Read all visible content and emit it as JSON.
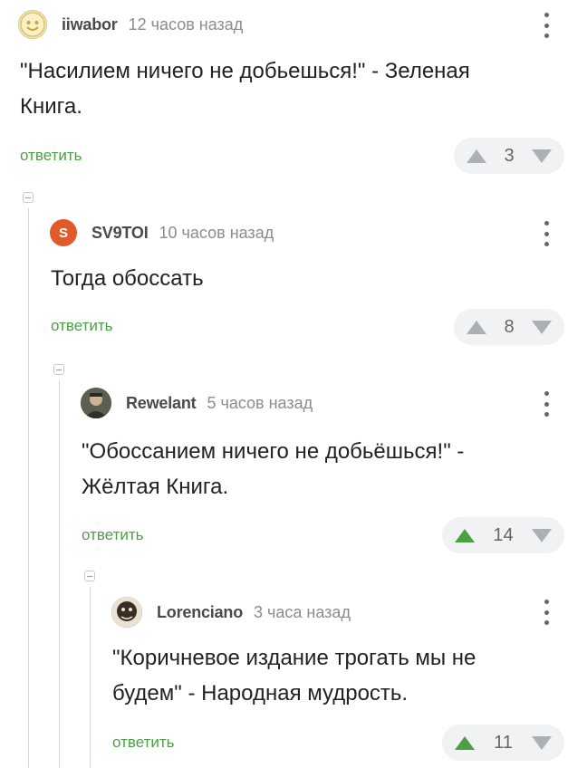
{
  "colors": {
    "accent_green": "#4d9f43",
    "vote_neutral": "#aab0b4",
    "avatar_sv9toi": "#e05a2a"
  },
  "common": {
    "reply_label": "ответить"
  },
  "comments": [
    {
      "username": "iiwabor",
      "time": "12 часов назад",
      "avatar_icon": "smiley-face-icon",
      "text_lines": [
        "\"Насилием ничего не добьешься!\" - Зеленая",
        "Книга."
      ],
      "rating": "3",
      "upvoted": false
    },
    {
      "username": "SV9TOI",
      "time": "10 часов назад",
      "avatar_letter": "S",
      "text_lines": [
        "Тогда обоссать"
      ],
      "rating": "8",
      "upvoted": false
    },
    {
      "username": "Rewelant",
      "time": "5 часов назад",
      "avatar_icon": "photo-avatar-icon",
      "text_lines": [
        "\"Обоссанием ничего не добьёшься!\" -",
        "Жёлтая Книга."
      ],
      "rating": "14",
      "upvoted": true
    },
    {
      "username": "Lorenciano",
      "time": "3 часа назад",
      "avatar_icon": "photo-avatar-icon",
      "text_lines": [
        "\"Коричневое издание трогать мы не",
        "будем\" - Народная мудрость."
      ],
      "rating": "11",
      "upvoted": true
    }
  ]
}
